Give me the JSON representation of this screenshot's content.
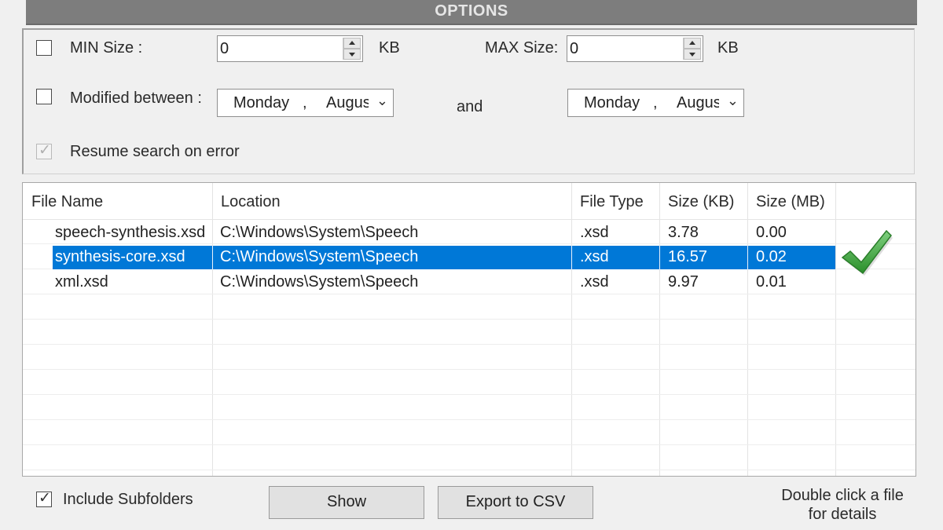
{
  "header": {
    "title": "OPTIONS"
  },
  "options": {
    "min_size": {
      "label": "MIN Size :",
      "value": "0",
      "unit": "KB",
      "checked": false
    },
    "max_size": {
      "label": "MAX Size:",
      "value": "0",
      "unit": "KB"
    },
    "modified": {
      "label": "Modified between :",
      "from": {
        "day": "Monday",
        "separator": ",",
        "month": "Augus"
      },
      "and_label": "and",
      "to": {
        "day": "Monday",
        "separator": ",",
        "month": "Augus"
      },
      "checked": false
    },
    "resume": {
      "label": "Resume search on error",
      "checked": true,
      "enabled": false
    }
  },
  "results": {
    "columns": [
      "File Name",
      "Location",
      "File Type",
      "Size (KB)",
      "Size (MB)"
    ],
    "rows": [
      {
        "name": "speech-synthesis.xsd",
        "location": "C:\\Windows\\System\\Speech",
        "type": ".xsd",
        "kb": "3.78",
        "mb": "0.00",
        "selected": false
      },
      {
        "name": "synthesis-core.xsd",
        "location": "C:\\Windows\\System\\Speech",
        "type": ".xsd",
        "kb": "16.57",
        "mb": "0.02",
        "selected": true
      },
      {
        "name": "xml.xsd",
        "location": "C:\\Windows\\System\\Speech",
        "type": ".xsd",
        "kb": "9.97",
        "mb": "0.01",
        "selected": false
      }
    ]
  },
  "bottom": {
    "include_subfolders": {
      "label": "Include Subfolders",
      "checked": true
    },
    "show_label": "Show",
    "export_label": "Export to CSV",
    "hint_line1": "Double click a file",
    "hint_line2": "for details"
  },
  "colors": {
    "selection": "#0078d7",
    "header_bar": "#7d7d7d",
    "checkmark": "#3aa63a"
  },
  "icons": {
    "selected_row_marker": "green-checkmark-icon"
  }
}
